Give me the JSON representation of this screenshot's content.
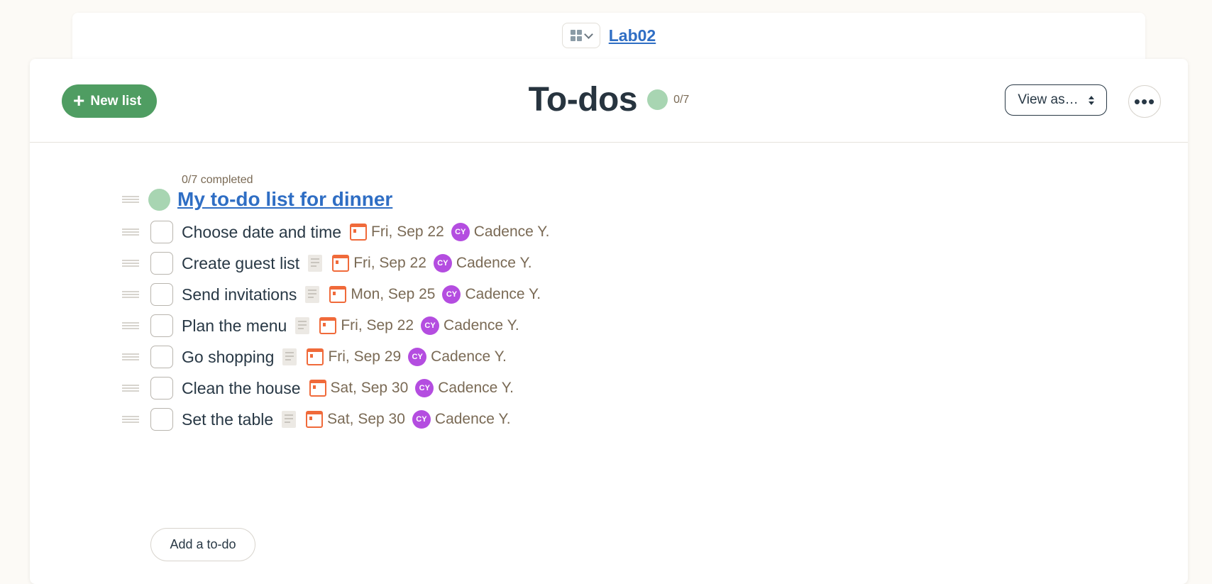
{
  "project": {
    "name": "Lab02",
    "switcher_icon": "grid-icon"
  },
  "header": {
    "new_list_label": "New list",
    "title": "To-dos",
    "progress": "0/7",
    "progress_fraction": 0,
    "view_as_label": "View as…",
    "more_label": "•••"
  },
  "list": {
    "completed_text": "0/7 completed",
    "title": "My to-do list for dinner",
    "add_todo_label": "Add a to-do",
    "todos": [
      {
        "text": "Choose date and time",
        "has_notes": false,
        "due": "Fri, Sep 22",
        "assignee_initials": "CY",
        "assignee": "Cadence Y."
      },
      {
        "text": "Create guest list",
        "has_notes": true,
        "due": "Fri, Sep 22",
        "assignee_initials": "CY",
        "assignee": "Cadence Y."
      },
      {
        "text": "Send invitations",
        "has_notes": true,
        "due": "Mon, Sep 25",
        "assignee_initials": "CY",
        "assignee": "Cadence Y."
      },
      {
        "text": "Plan the menu",
        "has_notes": true,
        "due": "Fri, Sep 22",
        "assignee_initials": "CY",
        "assignee": "Cadence Y."
      },
      {
        "text": "Go shopping",
        "has_notes": true,
        "due": "Fri, Sep 29",
        "assignee_initials": "CY",
        "assignee": "Cadence Y."
      },
      {
        "text": "Clean the house",
        "has_notes": false,
        "due": "Sat, Sep 30",
        "assignee_initials": "CY",
        "assignee": "Cadence Y."
      },
      {
        "text": "Set the table",
        "has_notes": true,
        "due": "Sat, Sep 30",
        "assignee_initials": "CY",
        "assignee": "Cadence Y."
      }
    ]
  },
  "colors": {
    "accent_green": "#4f9d62",
    "progress_green": "#a8d5b2",
    "link_blue": "#2f6ec4",
    "due_orange": "#f06a3a",
    "avatar_purple": "#b44de0"
  }
}
